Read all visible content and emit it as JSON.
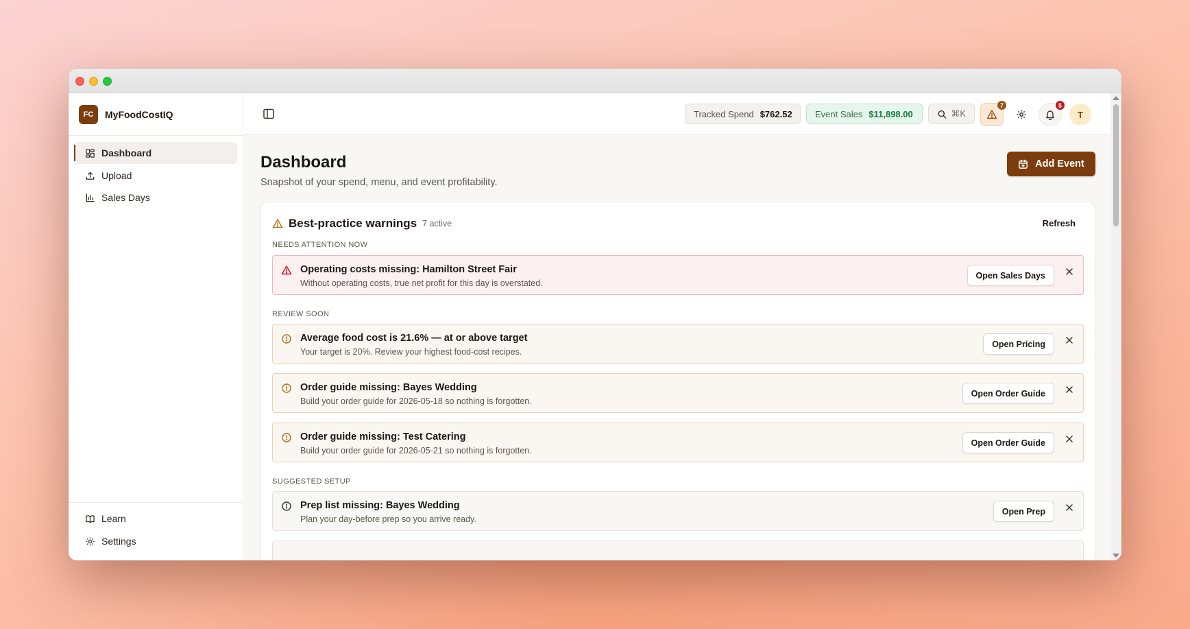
{
  "colors": {
    "brand": "#7c3d0e",
    "critical": "#c4161c",
    "review": "#b5721a",
    "success": "#167a3e"
  },
  "app": {
    "logo_text": "FC",
    "name": "MyFoodCostIQ"
  },
  "sidebar": {
    "items": [
      {
        "label": "Dashboard",
        "icon": "dashboard-icon"
      },
      {
        "label": "Upload",
        "icon": "upload-icon"
      },
      {
        "label": "Sales Days",
        "icon": "bar-chart-icon"
      }
    ],
    "footer": [
      {
        "label": "Learn",
        "icon": "book-icon"
      },
      {
        "label": "Settings",
        "icon": "gear-icon"
      }
    ]
  },
  "topbar": {
    "tracked_spend_label": "Tracked Spend",
    "tracked_spend_value": "$762.52",
    "event_sales_label": "Event Sales",
    "event_sales_value": "$11,898.00",
    "search_shortcut": "⌘K",
    "warnings_count": "7",
    "notifications_count": "5",
    "avatar_initial": "T"
  },
  "page": {
    "title": "Dashboard",
    "subtitle": "Snapshot of your spend, menu, and event profitability.",
    "add_event_label": "Add Event"
  },
  "warnings_card": {
    "title": "Best-practice warnings",
    "active_count": "7 active",
    "refresh_label": "Refresh",
    "sections": {
      "now": "NEEDS ATTENTION NOW",
      "soon": "REVIEW SOON",
      "setup": "SUGGESTED SETUP"
    },
    "items": [
      {
        "title": "Operating costs missing: Hamilton Street Fair",
        "desc": "Without operating costs, true net profit for this day is overstated.",
        "action": "Open Sales Days"
      },
      {
        "title": "Average food cost is 21.6% — at or above target",
        "desc": "Your target is 20%. Review your highest food-cost recipes.",
        "action": "Open Pricing"
      },
      {
        "title": "Order guide missing: Bayes Wedding",
        "desc": "Build your order guide for 2026-05-18 so nothing is forgotten.",
        "action": "Open Order Guide"
      },
      {
        "title": "Order guide missing: Test Catering",
        "desc": "Build your order guide for 2026-05-21 so nothing is forgotten.",
        "action": "Open Order Guide"
      },
      {
        "title": "Prep list missing: Bayes Wedding",
        "desc": "Plan your day-before prep so you arrive ready.",
        "action": "Open Prep"
      }
    ]
  }
}
